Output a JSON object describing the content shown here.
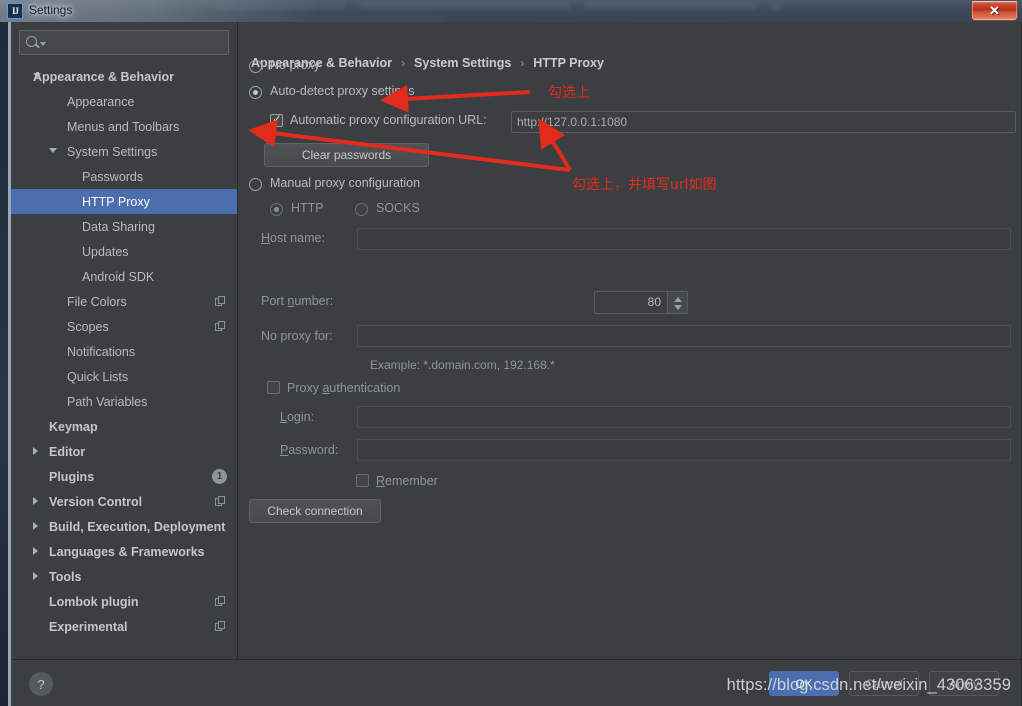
{
  "window": {
    "title": "Settings",
    "app_icon": "intellij-idea-icon",
    "close_label": "✕"
  },
  "search": {
    "value": "",
    "placeholder": "",
    "icon": "search-icon"
  },
  "sidebar": {
    "items": [
      {
        "label": "Appearance & Behavior",
        "indent": 22,
        "arrow": "down",
        "bold": true,
        "selected": false,
        "badge": null,
        "copy": false
      },
      {
        "label": "Appearance",
        "indent": 56,
        "arrow": "none",
        "bold": false,
        "selected": false,
        "badge": null,
        "copy": false
      },
      {
        "label": "Menus and Toolbars",
        "indent": 56,
        "arrow": "none",
        "bold": false,
        "selected": false,
        "badge": null,
        "copy": false
      },
      {
        "label": "System Settings",
        "indent": 56,
        "arrow": "down",
        "arrowLeft": 38,
        "bold": false,
        "selected": false,
        "badge": null,
        "copy": false
      },
      {
        "label": "Passwords",
        "indent": 71,
        "arrow": "none",
        "bold": false,
        "selected": false,
        "badge": null,
        "copy": false
      },
      {
        "label": "HTTP Proxy",
        "indent": 71,
        "arrow": "none",
        "bold": false,
        "selected": true,
        "badge": null,
        "copy": false
      },
      {
        "label": "Data Sharing",
        "indent": 71,
        "arrow": "none",
        "bold": false,
        "selected": false,
        "badge": null,
        "copy": false
      },
      {
        "label": "Updates",
        "indent": 71,
        "arrow": "none",
        "bold": false,
        "selected": false,
        "badge": null,
        "copy": false
      },
      {
        "label": "Android SDK",
        "indent": 71,
        "arrow": "none",
        "bold": false,
        "selected": false,
        "badge": null,
        "copy": false
      },
      {
        "label": "File Colors",
        "indent": 56,
        "arrow": "none",
        "bold": false,
        "selected": false,
        "badge": null,
        "copy": true
      },
      {
        "label": "Scopes",
        "indent": 56,
        "arrow": "none",
        "bold": false,
        "selected": false,
        "badge": null,
        "copy": true
      },
      {
        "label": "Notifications",
        "indent": 56,
        "arrow": "none",
        "bold": false,
        "selected": false,
        "badge": null,
        "copy": false
      },
      {
        "label": "Quick Lists",
        "indent": 56,
        "arrow": "none",
        "bold": false,
        "selected": false,
        "badge": null,
        "copy": false
      },
      {
        "label": "Path Variables",
        "indent": 56,
        "arrow": "none",
        "bold": false,
        "selected": false,
        "badge": null,
        "copy": false
      },
      {
        "label": "Keymap",
        "indent": 38,
        "arrow": "none",
        "bold": true,
        "selected": false,
        "badge": null,
        "copy": false
      },
      {
        "label": "Editor",
        "indent": 38,
        "arrow": "right",
        "arrowLeft": 22,
        "bold": true,
        "selected": false,
        "badge": null,
        "copy": false
      },
      {
        "label": "Plugins",
        "indent": 38,
        "arrow": "none",
        "bold": true,
        "selected": false,
        "badge": "1",
        "copy": false
      },
      {
        "label": "Version Control",
        "indent": 38,
        "arrow": "right",
        "arrowLeft": 22,
        "bold": true,
        "selected": false,
        "badge": null,
        "copy": true
      },
      {
        "label": "Build, Execution, Deployment",
        "indent": 38,
        "arrow": "right",
        "arrowLeft": 22,
        "bold": true,
        "selected": false,
        "badge": null,
        "copy": false
      },
      {
        "label": "Languages & Frameworks",
        "indent": 38,
        "arrow": "right",
        "arrowLeft": 22,
        "bold": true,
        "selected": false,
        "badge": null,
        "copy": false
      },
      {
        "label": "Tools",
        "indent": 38,
        "arrow": "right",
        "arrowLeft": 22,
        "bold": true,
        "selected": false,
        "badge": null,
        "copy": false
      },
      {
        "label": "Lombok plugin",
        "indent": 38,
        "arrow": "none",
        "bold": true,
        "selected": false,
        "badge": null,
        "copy": true
      },
      {
        "label": "Experimental",
        "indent": 38,
        "arrow": "none",
        "bold": true,
        "selected": false,
        "badge": null,
        "copy": true
      }
    ]
  },
  "breadcrumb": {
    "part1": "Appearance & Behavior",
    "sep1": "›",
    "part2": "System Settings",
    "sep2": "›",
    "part3": "HTTP Proxy"
  },
  "proxy": {
    "mode": "auto-detect",
    "no_proxy_label": "No proxy",
    "auto_detect_label": "Auto-detect proxy settings",
    "auto_config_url_label": "Automatic proxy configuration URL:",
    "auto_config_url_value": "http://127.0.0.1:1080",
    "auto_config_url_checked": true,
    "clear_passwords_label": "Clear passwords",
    "manual_label": "Manual proxy configuration",
    "http_label": "HTTP",
    "socks_label": "SOCKS",
    "protocol_selected": "HTTP",
    "host_name_label": "Host name:",
    "host_name_value": "",
    "port_number_label": "Port number:",
    "port_number_value": "80",
    "no_proxy_for_label": "No proxy for:",
    "no_proxy_for_value": "",
    "example_text": "Example: *.domain.com, 192.168.*",
    "proxy_auth_label": "Proxy authentication",
    "proxy_auth_checked": false,
    "login_label": "Login:",
    "login_value": "",
    "password_label": "Password:",
    "password_value": "",
    "remember_label": "Remember",
    "remember_checked": false,
    "check_connection_label": "Check connection"
  },
  "footer": {
    "help_label": "?",
    "ok_label": "OK",
    "cancel_label": "Cancel",
    "apply_label": "Apply"
  },
  "annotations": {
    "note1": "勾选上",
    "note2": "勾选上，并填写url如图",
    "color": "#e32b1c"
  },
  "watermark": "https://blog.csdn.net/weixin_43063359"
}
